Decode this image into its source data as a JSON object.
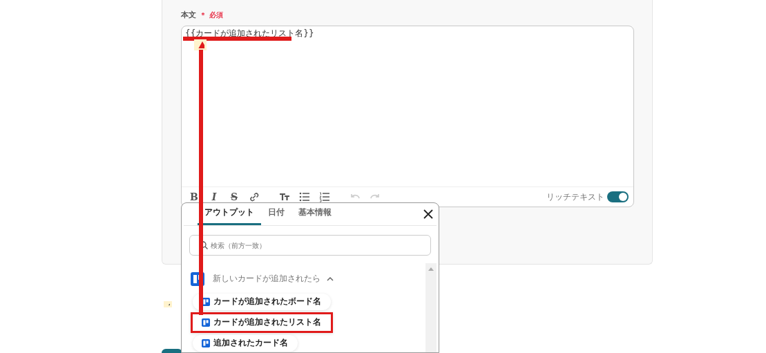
{
  "field": {
    "label": "本文",
    "required_mark": "＊",
    "required_text": "必須",
    "value": "{{カードが追加されたリスト名}}"
  },
  "toolbar": [
    {
      "kind": "bold",
      "label": "B",
      "disabled": false
    },
    {
      "kind": "italic",
      "label": "I",
      "disabled": false
    },
    {
      "kind": "strike",
      "label": "S",
      "disabled": false
    },
    {
      "kind": "link",
      "disabled": false
    },
    {
      "kind": "size",
      "disabled": false
    },
    {
      "kind": "bullets",
      "disabled": false
    },
    {
      "kind": "numbers",
      "disabled": false
    },
    {
      "kind": "undo",
      "disabled": true
    },
    {
      "kind": "redo",
      "disabled": true
    }
  ],
  "rich_text": {
    "label": "リッチテキスト",
    "on": true
  },
  "popup": {
    "tabs": [
      {
        "label": "アウトプット",
        "selected": true
      },
      {
        "label": "日付",
        "selected": false
      },
      {
        "label": "基本情報",
        "selected": false
      }
    ],
    "search": {
      "placeholder": "検索（前方一致）"
    },
    "group": {
      "title": "新しいカードが追加されたら",
      "expanded": true,
      "items": [
        {
          "label": "カードが追加されたボード名",
          "highlighted": false
        },
        {
          "label": "カードが追加されたリスト名",
          "highlighted": true
        },
        {
          "label": "追加されたカード名",
          "highlighted": false
        }
      ]
    }
  }
}
